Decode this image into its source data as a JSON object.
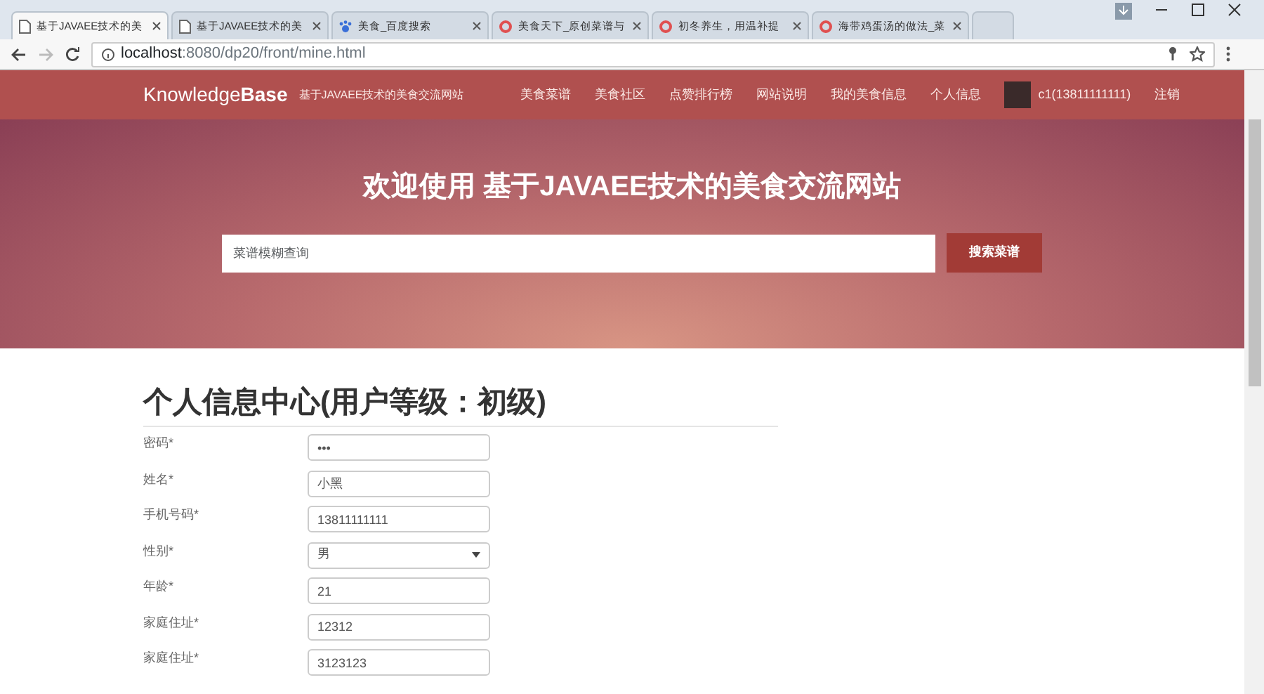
{
  "browser": {
    "tabs": [
      {
        "title": "基于JAVAEE技术的美",
        "selected": true
      },
      {
        "title": "基于JAVAEE技术的美",
        "selected": false
      },
      {
        "title": "美食_百度搜索",
        "selected": false
      },
      {
        "title": "美食天下_原创菜谱与",
        "selected": false
      },
      {
        "title": "初冬养生，用温补提",
        "selected": false
      },
      {
        "title": "海带鸡蛋汤的做法_菜",
        "selected": false
      }
    ],
    "url_host": "localhost",
    "url_path": ":8080/dp20/front/mine.html"
  },
  "navbar": {
    "brand_light": "Knowledge",
    "brand_bold": "Base",
    "subtitle": "基于JAVAEE技术的美食交流网站",
    "links": [
      "美食菜谱",
      "美食社区",
      "点赞排行榜",
      "网站说明",
      "我的美食信息",
      "个人信息"
    ],
    "user": "c1(13811111111)",
    "logout": "注销"
  },
  "hero": {
    "title": "欢迎使用 基于JAVAEE技术的美食交流网站",
    "search": {
      "placeholder": "菜谱模糊查询"
    },
    "button": "搜索菜谱"
  },
  "page": {
    "heading": "个人信息中心(用户等级：初级)",
    "fields": [
      {
        "label": "密码*",
        "kind": "input",
        "value": "•••"
      },
      {
        "label": "姓名*",
        "kind": "input",
        "value": "小黑"
      },
      {
        "label": "手机号码*",
        "kind": "input",
        "value": "13811111111"
      },
      {
        "label": "性别*",
        "kind": "select",
        "value": "男"
      },
      {
        "label": "年龄*",
        "kind": "input",
        "value": "21"
      },
      {
        "label": "家庭住址*",
        "kind": "input",
        "value": "12312"
      },
      {
        "label": "家庭住址*",
        "kind": "input",
        "value": "3123123"
      }
    ]
  }
}
